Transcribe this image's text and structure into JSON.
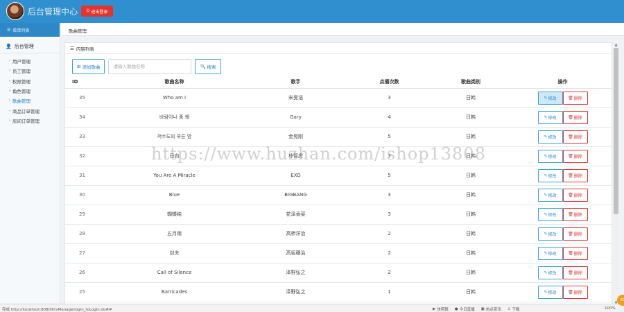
{
  "header": {
    "title": "后台管理中心",
    "logout_label": "退出登录",
    "logout_icon": "power-icon",
    "bg_color": "#2f8fcf"
  },
  "sidebar": {
    "top_label": "菜单列表",
    "group_label": "后台管理",
    "items": [
      {
        "label": "用户管理",
        "active": false
      },
      {
        "label": "员工管理",
        "active": false
      },
      {
        "label": "权限管理",
        "active": false
      },
      {
        "label": "角色管理",
        "active": false
      },
      {
        "label": "歌曲管理",
        "active": true
      },
      {
        "label": "商品订单管理",
        "active": false
      },
      {
        "label": "房间订单管理",
        "active": false
      }
    ]
  },
  "breadcrumb": "歌曲管理",
  "panel": {
    "title": "内容列表",
    "add_label": "添加歌曲",
    "search_placeholder": "请输入歌曲名称",
    "search_label": "搜索"
  },
  "table": {
    "columns": [
      "ID",
      "歌曲名称",
      "歌手",
      "点播次数",
      "歌曲类别",
      "操作"
    ],
    "edit_label": "修改",
    "delete_label": "删除",
    "rows": [
      {
        "id": "35",
        "name": "Who am I",
        "singer": "宋旻浩",
        "plays": "3",
        "category": "日韩"
      },
      {
        "id": "34",
        "name": "바람이나 좀 쐐",
        "singer": "Gary",
        "plays": "4",
        "category": "日韩"
      },
      {
        "id": "33",
        "name": "저수도의 푸른 밤",
        "singer": "金晃刚",
        "plays": "5",
        "category": "日韩"
      },
      {
        "id": "32",
        "name": "日向",
        "singer": "朴智虎",
        "plays": "3",
        "category": "日韩"
      },
      {
        "id": "31",
        "name": "You Are A Miracle",
        "singer": "EXO",
        "plays": "5",
        "category": "日韩"
      },
      {
        "id": "30",
        "name": "Blue",
        "singer": "BIGBANG",
        "plays": "3",
        "category": "日韩"
      },
      {
        "id": "29",
        "name": "蝴蝶结",
        "singer": "花泽香菜",
        "plays": "3",
        "category": "日韩"
      },
      {
        "id": "28",
        "name": "五月雨",
        "singer": "高桥洋治",
        "plays": "2",
        "category": "日韩"
      },
      {
        "id": "27",
        "name": "剑夫",
        "singer": "高坂穗治",
        "plays": "2",
        "category": "日韩"
      },
      {
        "id": "26",
        "name": "Call of Silence",
        "singer": "泽野弘之",
        "plays": "2",
        "category": "日韩"
      },
      {
        "id": "25",
        "name": "Barricades",
        "singer": "泽野弘之",
        "plays": "1",
        "category": "日韩"
      }
    ]
  },
  "watermark": "https://www.huzhan.com/ishop13808",
  "statusbar": {
    "url": "完成 http://localhost:8080/ktvManage/login_toLogin.do##",
    "items": [
      "快剪辑",
      "今日直播",
      "热点资讯",
      "下载",
      "100%"
    ],
    "badge": "80"
  },
  "colors": {
    "primary": "#2e88c7",
    "danger": "#e3352f"
  }
}
